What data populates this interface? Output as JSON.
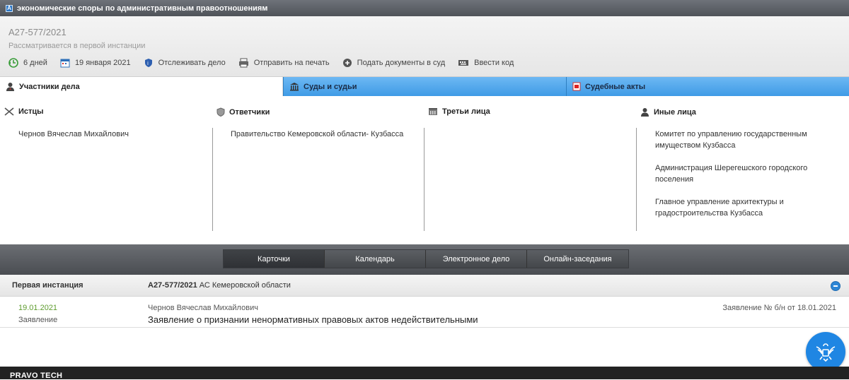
{
  "topbar": {
    "title": "экономические споры по административным правоотношениям"
  },
  "header": {
    "case_number": "А27-577/2021",
    "status": "Рассматривается в первой инстанции",
    "actions": [
      {
        "icon": "back-clock-icon",
        "label": "6 дней"
      },
      {
        "icon": "calendar-icon",
        "label": "19 января 2021"
      },
      {
        "icon": "shield-track-icon",
        "label": "Отслеживать дело"
      },
      {
        "icon": "printer-icon",
        "label": "Отправить на печать"
      },
      {
        "icon": "plus-circle-icon",
        "label": "Подать документы в суд"
      },
      {
        "icon": "keyboard-icon",
        "label": "Ввести код"
      }
    ]
  },
  "tabs": [
    {
      "label": "Участники дела",
      "active": true
    },
    {
      "label": "Суды и судьи",
      "active": false
    },
    {
      "label": "Судебные акты",
      "active": false
    }
  ],
  "participants": {
    "plaintiffs": {
      "title": "Истцы",
      "items": [
        "Чернов Вячеслав Михайлович"
      ]
    },
    "defendants": {
      "title": "Ответчики",
      "items": [
        "Правительство Кемеровской области- Кузбасса"
      ]
    },
    "third_parties": {
      "title": "Третьи лица",
      "items": []
    },
    "others": {
      "title": "Иные лица",
      "items": [
        "Комитет по управлению государственным имуществом Кузбасса",
        "Администрация Шерегешского городского поселения",
        "Главное управление архитектуры и градостроительства Кузбасса"
      ]
    }
  },
  "nav": {
    "items": [
      "Карточки",
      "Календарь",
      "Электронное дело",
      "Онлайн-заседания"
    ],
    "active_index": 0
  },
  "instance": {
    "title": "Первая инстанция",
    "case_bold": "А27-577/2021",
    "court": " АС Кемеровской области"
  },
  "document": {
    "date": "19.01.2021",
    "type": "Заявление",
    "author": "Чернов Вячеслав Михайлович",
    "title": "Заявление о признании ненормативных правовых актов недействительными",
    "reference": "Заявление № б/н от 18.01.2021"
  },
  "footer": {
    "brand": "PRAVO TECH"
  },
  "colors": {
    "accent_blue": "#3f9be6",
    "date_green": "#5e9c2e",
    "fab_blue": "#1f86e3"
  }
}
